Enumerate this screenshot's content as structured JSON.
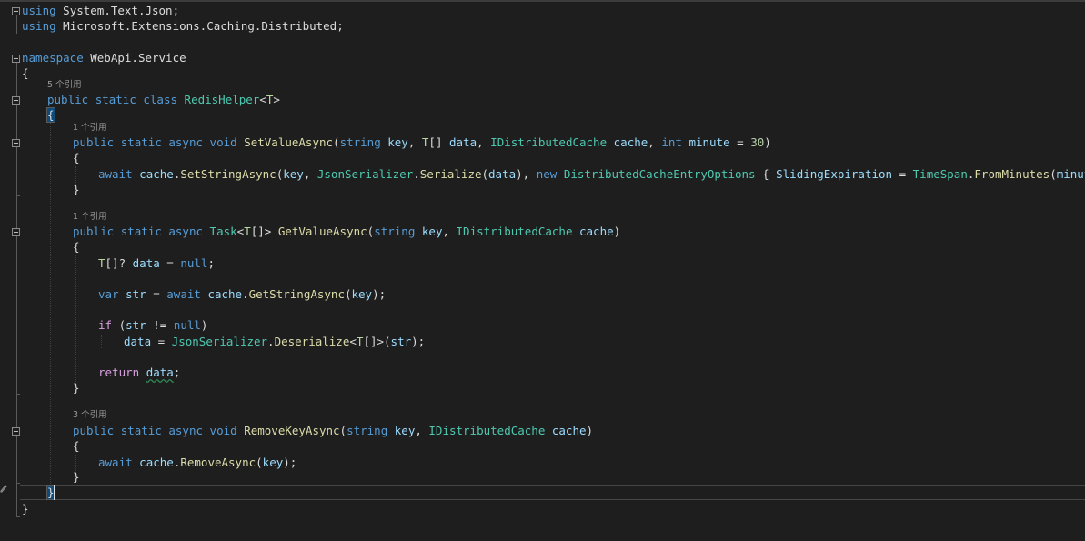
{
  "code": {
    "line_using_1": "using System.Text.Json;",
    "line_using_2": "using Microsoft.Extensions.Caching.Distributed;",
    "line_namespace": "namespace WebApi.Service",
    "line_class": "public static class RedisHelper<T>",
    "line_set_sig": "public static async void SetValueAsync(string key, T[] data, IDistributedCache cache, int minute = 30)",
    "line_set_body": "await cache.SetStringAsync(key, JsonSerializer.Serialize(data), new DistributedCacheEntryOptions { SlidingExpiration = TimeSpan.FromMinutes(minute) });",
    "line_get_sig": "public static async Task<T[]> GetValueAsync(string key, IDistributedCache cache)",
    "line_get_decl": "T[]? data = null;",
    "line_get_var": "var str = await cache.GetStringAsync(key);",
    "line_get_if": "if (str != null)",
    "line_get_assign": "data = JsonSerializer.Deserialize<T[]>(str);",
    "line_get_return": "return data;",
    "line_remove_sig": "public static async void RemoveKeyAsync(string key, IDistributedCache cache)",
    "line_remove_body": "await cache.RemoveAsync(key);",
    "open_brace": "{",
    "close_brace": "}"
  },
  "code_lens": {
    "class_refs": "5 个引用",
    "set_refs": "1 个引用",
    "get_refs": "1 个引用",
    "remove_refs": "3 个引用"
  },
  "colors": {
    "background": "#1e1e1e",
    "keyword": "#569cd6",
    "control_keyword": "#d8a0df",
    "type": "#4ec9b0",
    "type_parameter": "#b8d7a3",
    "method": "#dcdcaa",
    "parameter": "#9cdcfe",
    "number": "#b5cea8",
    "plain": "#dcdcdc"
  },
  "icons": {
    "fold_marker": "collapse-minus-icon",
    "edit_indicator": "pencil-icon"
  }
}
